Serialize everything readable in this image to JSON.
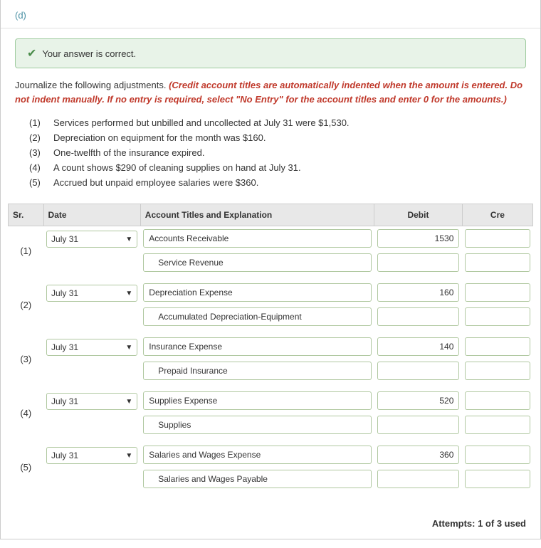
{
  "section_d": {
    "label": "(d)"
  },
  "correct_banner": {
    "icon": "✔",
    "text": "Your answer is correct."
  },
  "instructions": {
    "main": "Journalize the following adjustments.",
    "italic": "(Credit account titles are automatically indented when the amount is entered. Do not indent manually. If no entry is required, select \"No Entry\" for the account titles and enter 0 for the amounts.)"
  },
  "adjustments": [
    {
      "num": "(1)",
      "text": "Services performed but unbilled and uncollected at July 31 were $1,530."
    },
    {
      "num": "(2)",
      "text": "Depreciation on equipment for the month was $160."
    },
    {
      "num": "(3)",
      "text": "One-twelfth of the insurance expired."
    },
    {
      "num": "(4)",
      "text": "A count shows $290 of cleaning supplies on hand at July 31."
    },
    {
      "num": "(5)",
      "text": "Accrued but unpaid employee salaries were $360."
    }
  ],
  "table": {
    "headers": {
      "sr": "Sr.",
      "date": "Date",
      "account": "Account Titles and Explanation",
      "debit": "Debit",
      "credit": "Cre"
    },
    "rows": [
      {
        "sr": "(1)",
        "date": "July 31",
        "entries": [
          {
            "account": "Accounts Receivable",
            "debit": "1530",
            "credit": "",
            "indented": false
          },
          {
            "account": "Service Revenue",
            "debit": "",
            "credit": "",
            "indented": true
          }
        ]
      },
      {
        "sr": "(2)",
        "date": "July 31",
        "entries": [
          {
            "account": "Depreciation Expense",
            "debit": "160",
            "credit": "",
            "indented": false
          },
          {
            "account": "Accumulated Depreciation-Equipment",
            "debit": "",
            "credit": "",
            "indented": true
          }
        ]
      },
      {
        "sr": "(3)",
        "date": "July 31",
        "entries": [
          {
            "account": "Insurance Expense",
            "debit": "140",
            "credit": "",
            "indented": false
          },
          {
            "account": "Prepaid Insurance",
            "debit": "",
            "credit": "",
            "indented": true
          }
        ]
      },
      {
        "sr": "(4)",
        "date": "July 31",
        "entries": [
          {
            "account": "Supplies Expense",
            "debit": "520",
            "credit": "",
            "indented": false
          },
          {
            "account": "Supplies",
            "debit": "",
            "credit": "",
            "indented": true
          }
        ]
      },
      {
        "sr": "(5)",
        "date": "July 31",
        "entries": [
          {
            "account": "Salaries and Wages Expense",
            "debit": "360",
            "credit": "",
            "indented": false
          },
          {
            "account": "Salaries and Wages Payable",
            "debit": "",
            "credit": "",
            "indented": true
          }
        ]
      }
    ]
  },
  "attempts": "Attempts: 1 of 3 used"
}
